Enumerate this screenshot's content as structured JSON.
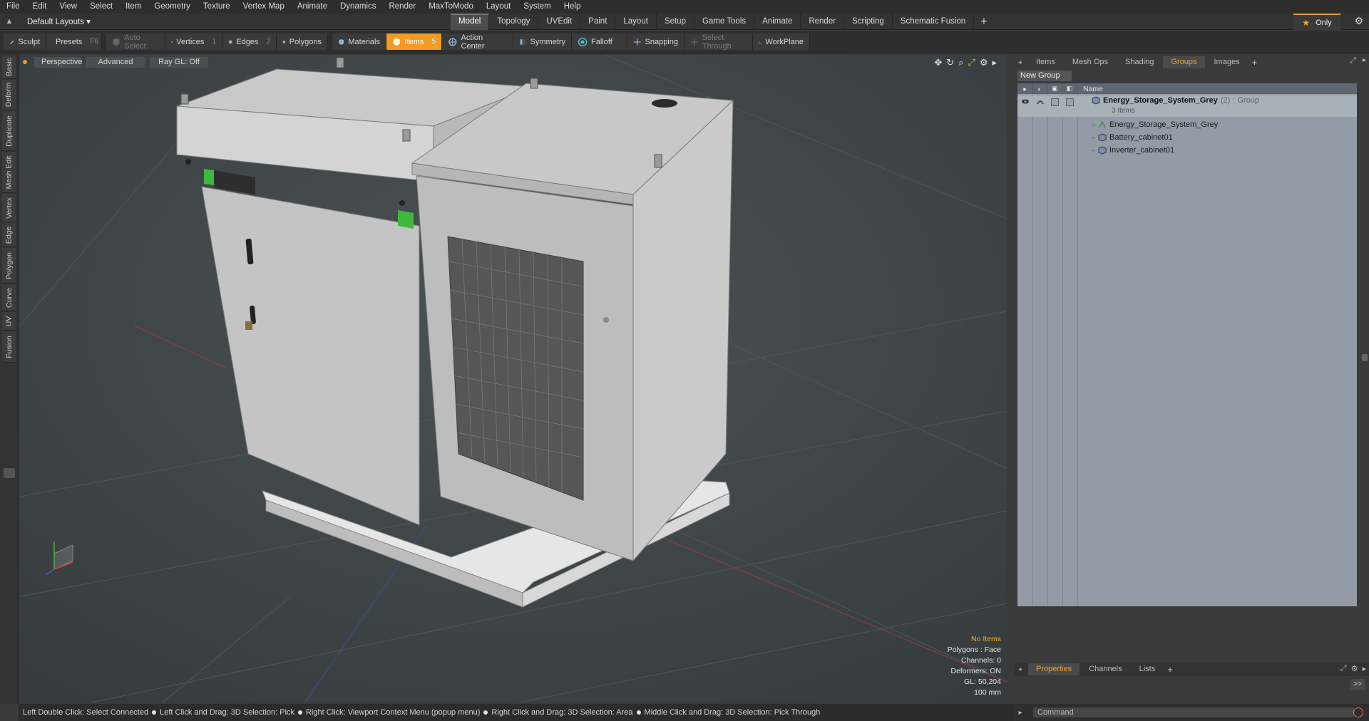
{
  "menu": [
    "File",
    "Edit",
    "View",
    "Select",
    "Item",
    "Geometry",
    "Texture",
    "Vertex Map",
    "Animate",
    "Dynamics",
    "Render",
    "MaxToModo",
    "Layout",
    "System",
    "Help"
  ],
  "layout": {
    "selector": "Default Layouts ▾",
    "only": "Only"
  },
  "mode_tabs": [
    "Model",
    "Topology",
    "UVEdit",
    "Paint",
    "Layout",
    "Setup",
    "Game Tools",
    "Animate",
    "Render",
    "Scripting",
    "Schematic Fusion"
  ],
  "mode_active": "Model",
  "toolbar": {
    "sculpt": "Sculpt",
    "presets": "Presets",
    "presets_key": "F6",
    "auto_select": "Auto Select",
    "vertices": "Vertices",
    "vertices_key": "1",
    "edges": "Edges",
    "edges_key": "2",
    "polygons": "Polygons",
    "materials": "Materials",
    "items": "Items",
    "items_key": "5",
    "action_center": "Action Center",
    "symmetry": "Symmetry",
    "falloff": "Falloff",
    "snapping": "Snapping",
    "select_through": "Select Through",
    "workplane": "WorkPlane"
  },
  "left_tabs": [
    "Basic",
    "Deform",
    "Duplicate",
    "Mesh Edit",
    "Vertex",
    "Edge",
    "Polygon",
    "Curve",
    "UV",
    "Fusion"
  ],
  "viewport": {
    "view": "Perspective",
    "shading": "Advanced",
    "raygl": "Ray GL: Off",
    "info": {
      "items": "No Items",
      "polygons": "Polygons : Face",
      "channels": "Channels: 0",
      "deformers": "Deformers: ON",
      "gl": "GL: 50,204",
      "scale": "100 mm"
    }
  },
  "status_hints": [
    "Left Double Click: Select Connected",
    "Left Click and Drag: 3D Selection: Pick",
    "Right Click: Viewport Context Menu (popup menu)",
    "Right Click and Drag: 3D Selection: Area",
    "Middle Click and Drag: 3D Selection: Pick Through"
  ],
  "right_panel": {
    "tabs": [
      "Items",
      "Mesh Ops",
      "Shading",
      "Groups",
      "Images"
    ],
    "active_tab": "Groups",
    "new_group": "New Group",
    "column_name": "Name",
    "tree": {
      "root": {
        "name": "Energy_Storage_System_Grey",
        "count": "(2)",
        "type": ": Group",
        "sub": "3 Items"
      },
      "children": [
        "Energy_Storage_System_Grey",
        "Battery_cabinet01",
        "Inverter_cabinet01"
      ]
    },
    "bottom_tabs": [
      "Properties",
      "Channels",
      "Lists"
    ],
    "bottom_active": "Properties",
    "go_label": ">>",
    "command_placeholder": "Command"
  },
  "colors": {
    "accent": "#f29b25",
    "tab_active_text": "#f0a030",
    "viewport_bg": "#3e4547",
    "tree_bg": "#939ca6"
  }
}
